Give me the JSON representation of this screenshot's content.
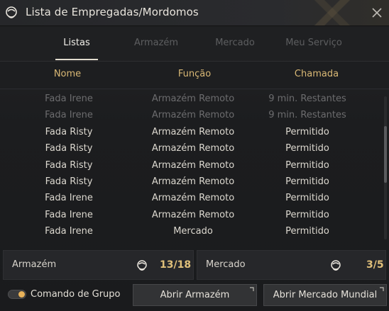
{
  "window": {
    "title": "Lista de Empregadas/Mordomos",
    "icon": "maid-icon",
    "close_icon": "close-icon"
  },
  "tabs": [
    {
      "label": "Listas",
      "active": true
    },
    {
      "label": "Armazém",
      "active": false
    },
    {
      "label": "Mercado",
      "active": false
    },
    {
      "label": "Meu Serviço",
      "active": false
    }
  ],
  "columns": {
    "name": "Nome",
    "function": "Função",
    "call": "Chamada"
  },
  "rows": [
    {
      "name": "Fada Irene",
      "function": "Armazém Remoto",
      "call": "9 min. Restantes",
      "available": false
    },
    {
      "name": "Fada Irene",
      "function": "Armazém Remoto",
      "call": "9 min. Restantes",
      "available": false
    },
    {
      "name": "Fada Risty",
      "function": "Armazém Remoto",
      "call": "Permitido",
      "available": true
    },
    {
      "name": "Fada Risty",
      "function": "Armazém Remoto",
      "call": "Permitido",
      "available": true
    },
    {
      "name": "Fada Risty",
      "function": "Armazém Remoto",
      "call": "Permitido",
      "available": true
    },
    {
      "name": "Fada Risty",
      "function": "Armazém Remoto",
      "call": "Permitido",
      "available": true
    },
    {
      "name": "Fada Irene",
      "function": "Armazém Remoto",
      "call": "Permitido",
      "available": true
    },
    {
      "name": "Fada Irene",
      "function": "Armazém Remoto",
      "call": "Permitido",
      "available": true
    },
    {
      "name": "Fada Irene",
      "function": "Mercado",
      "call": "Permitido",
      "available": true
    }
  ],
  "summary": {
    "storage_label": "Armazém",
    "storage_count": "13/18",
    "market_label": "Mercado",
    "market_count": "3/5"
  },
  "footer": {
    "group_command_label": "Comando de Grupo",
    "group_command_on": true,
    "open_storage_label": "Abrir Armazém",
    "open_market_label": "Abrir Mercado Mundial"
  },
  "colors": {
    "accent_gold": "#d9b875",
    "count_gold": "#e0c07a",
    "toggle_on": "#e8b25a",
    "dim_text": "#6c6c6e"
  }
}
